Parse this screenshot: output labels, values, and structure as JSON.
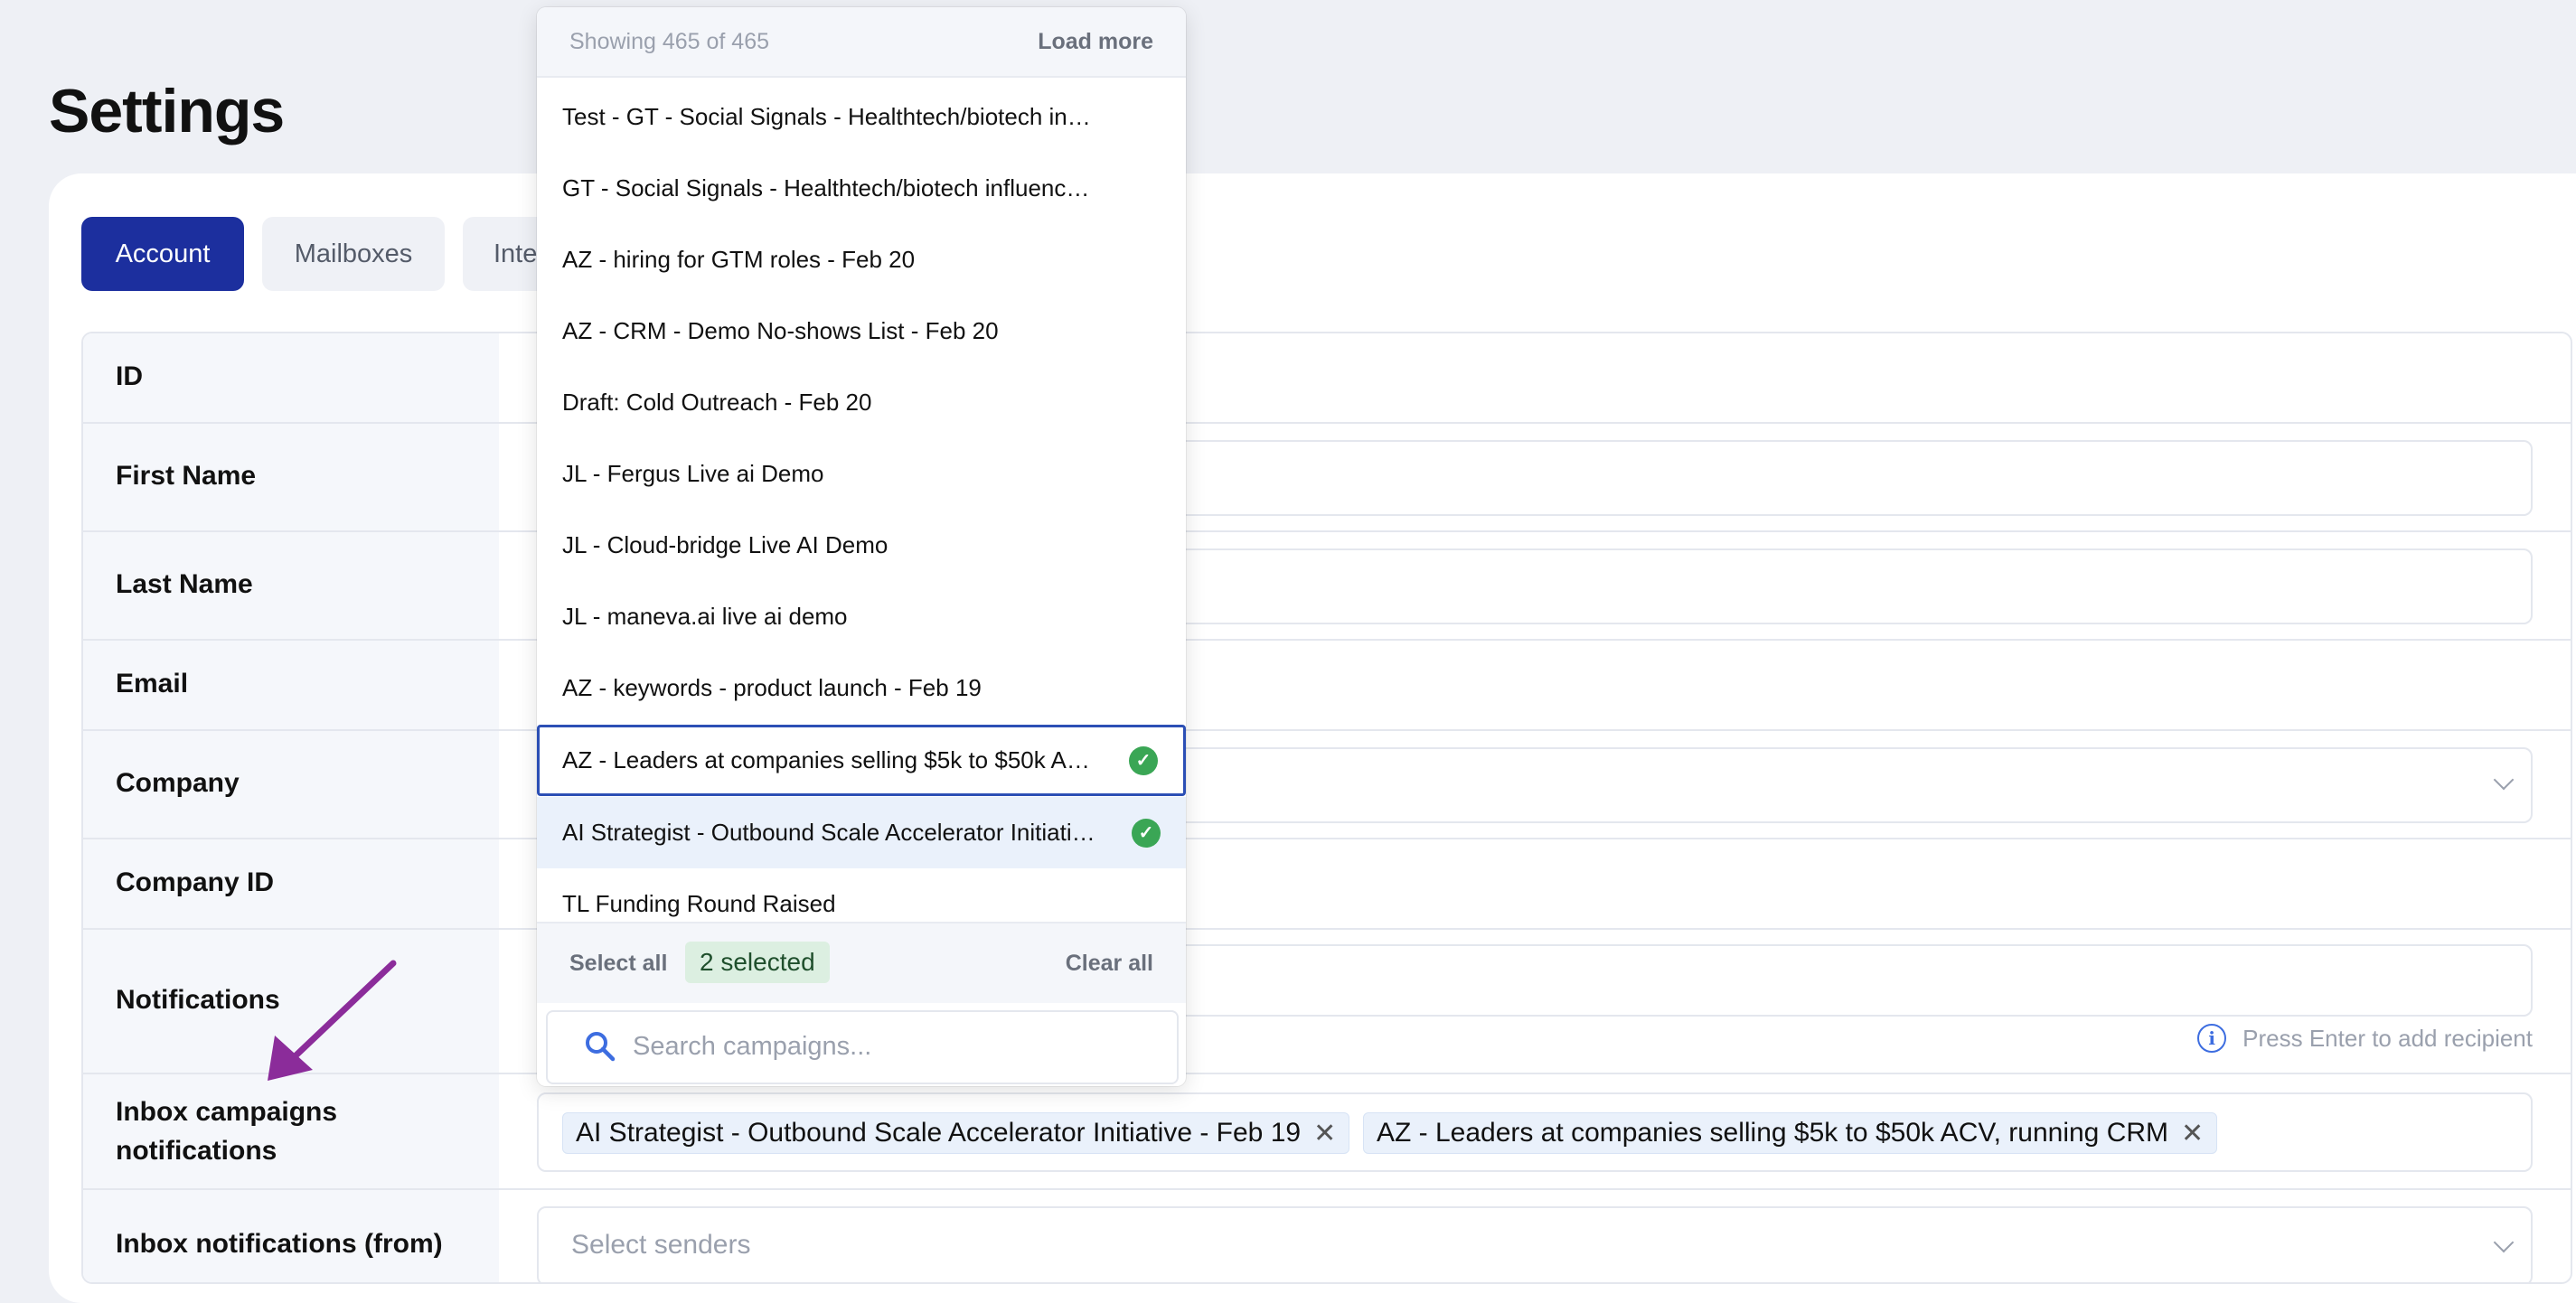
{
  "page": {
    "title": "Settings"
  },
  "tabs": [
    {
      "label": "Account",
      "active": true
    },
    {
      "label": "Mailboxes",
      "active": false
    },
    {
      "label": "Inte",
      "active": false
    }
  ],
  "rows": [
    {
      "label": "ID"
    },
    {
      "label": "First Name"
    },
    {
      "label": "Last Name"
    },
    {
      "label": "Email"
    },
    {
      "label": "Company"
    },
    {
      "label": "Company ID"
    },
    {
      "label": "Notifications",
      "hint": "Press Enter to add recipient"
    },
    {
      "label_line1": "Inbox campaigns",
      "label_line2": "notifications",
      "chips": [
        "AI Strategist - Outbound Scale Accelerator Initiative - Feb 19",
        "AZ - Leaders at companies selling $5k to $50k ACV, running CRM"
      ]
    },
    {
      "label": "Inbox notifications (from)",
      "placeholder": "Select senders"
    }
  ],
  "dropdown": {
    "showing": "Showing 465 of 465",
    "load_more": "Load more",
    "items": [
      {
        "label": "Test - GT - Social Signals - Healthtech/biotech influencers",
        "selected": false
      },
      {
        "label": "GT - Social Signals - Healthtech/biotech influencers",
        "selected": false
      },
      {
        "label": "AZ - hiring for GTM roles - Feb 20",
        "selected": false
      },
      {
        "label": "AZ - CRM - Demo No-shows List - Feb 20",
        "selected": false
      },
      {
        "label": "Draft: Cold Outreach - Feb 20",
        "selected": false
      },
      {
        "label": "JL - Fergus Live ai Demo",
        "selected": false
      },
      {
        "label": "JL - Cloud-bridge Live AI Demo",
        "selected": false
      },
      {
        "label": "JL - maneva.ai live ai demo",
        "selected": false
      },
      {
        "label": "AZ - keywords - product launch - Feb 19",
        "selected": false
      },
      {
        "label": "AZ - Leaders at companies selling $5k to $50k ACV, running CRM",
        "selected": true,
        "focused": true
      },
      {
        "label": "AI Strategist - Outbound Scale Accelerator Initiative - Feb 19",
        "selected": true
      },
      {
        "label": "TL Funding Round Raised",
        "selected": false
      }
    ],
    "select_all": "Select all",
    "selected_count": "2 selected",
    "clear_all": "Clear all",
    "search_placeholder": "Search campaigns..."
  },
  "colors": {
    "accent": "#1c2f9e",
    "check": "#3aa655",
    "arrow": "#8b2c9a"
  }
}
